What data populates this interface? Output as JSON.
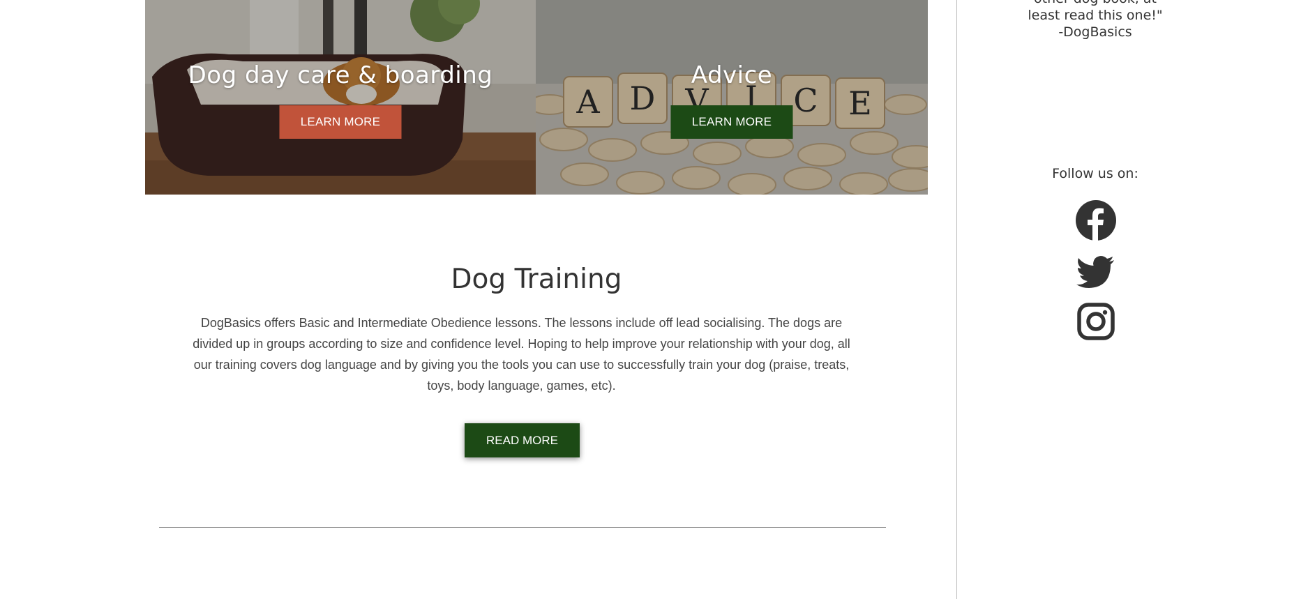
{
  "tiles": [
    {
      "title": "Dog day care & boarding",
      "button_label": "LEARN MORE",
      "button_color": "#c1533a"
    },
    {
      "title": "Advice",
      "button_label": "LEARN MORE",
      "button_color": "#1c4a15"
    }
  ],
  "training": {
    "title": "Dog Training",
    "body": "DogBasics offers Basic and Intermediate Obedience lessons. The lessons include off lead socialising. The dogs are divided up in groups according to size and confidence level. Hoping to help improve your relationship with your dog, all our training covers dog language and by giving you the tools you can use to successfully train your dog (praise, treats, toys, body language, games, etc).",
    "button_label": "READ MORE"
  },
  "sidebar": {
    "quote_lines": [
      "other dog book, at",
      "least read this one!\"",
      "-DogBasics"
    ],
    "follow_label": "Follow us on:",
    "social": [
      {
        "icon": "facebook-icon"
      },
      {
        "icon": "twitter-icon"
      },
      {
        "icon": "instagram-icon"
      }
    ]
  },
  "colors": {
    "accent_green": "#1c4a15",
    "accent_orange": "#c1533a",
    "text": "#333333"
  }
}
